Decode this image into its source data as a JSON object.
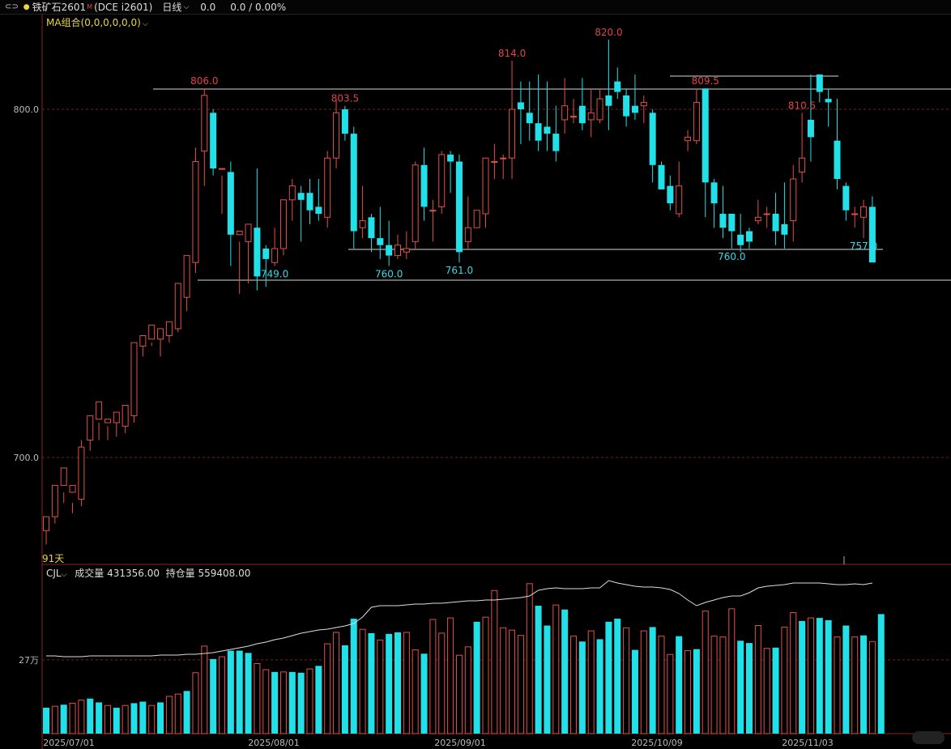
{
  "header": {
    "symbol": "铁矿石2601",
    "badge": "M",
    "exchange_code": "(DCE i2601)",
    "period": "日线",
    "last": "0.0",
    "change": "0.0 / 0.00%"
  },
  "indicators": {
    "ma_label": "MA组合(0,0,0,0,0,0)",
    "days_label": "91天",
    "volume_panel": "CJL",
    "volume_text": "成交量 431356.00",
    "oi_text": "持仓量 559408.00"
  },
  "colors": {
    "up": "#e0504a",
    "down": "#22e0e8",
    "grid": "#7a1f1f",
    "line": "#dddddd"
  },
  "chart_data": {
    "type": "candlestick",
    "price_axis_ticks": [
      800.0,
      700.0
    ],
    "volume_axis_tick": "27万",
    "date_labels": [
      "2025/07/01",
      "2025/08/01",
      "2025/09/01",
      "2025/10/09",
      "2025/11/03"
    ],
    "ylim": [
      671,
      832
    ],
    "candles": [
      [
        679,
        683,
        675,
        683
      ],
      [
        683,
        692,
        681,
        691
      ],
      [
        692,
        697,
        687,
        690
      ],
      [
        690,
        692,
        684,
        687
      ],
      [
        688,
        703,
        686,
        705
      ],
      [
        705,
        712,
        702,
        711
      ],
      [
        711,
        716,
        705,
        710
      ],
      [
        710,
        711,
        705,
        709
      ],
      [
        710,
        713,
        706,
        710
      ],
      [
        709,
        715,
        707,
        712
      ],
      [
        712,
        733,
        710,
        732
      ],
      [
        732,
        735,
        729,
        734
      ],
      [
        734,
        738,
        732,
        733
      ],
      [
        734,
        737,
        729,
        735
      ],
      [
        735,
        739,
        733,
        737
      ],
      [
        737,
        750,
        736,
        746
      ],
      [
        746,
        758,
        742,
        758
      ],
      [
        756,
        785,
        753,
        789
      ],
      [
        788,
        804,
        778,
        806
      ],
      [
        799,
        783,
        781,
        800
      ],
      [
        783,
        783,
        770,
        781
      ],
      [
        782,
        764,
        755,
        785
      ],
      [
        764,
        765,
        747,
        762
      ],
      [
        762,
        767,
        750,
        766
      ],
      [
        766,
        752,
        748,
        783
      ],
      [
        760,
        757,
        749,
        761
      ],
      [
        756,
        760,
        755,
        766
      ],
      [
        760,
        774,
        758,
        774
      ],
      [
        774,
        778,
        768,
        780
      ],
      [
        776,
        774,
        762,
        778
      ],
      [
        776,
        771,
        767,
        780
      ],
      [
        772,
        770,
        768,
        780
      ],
      [
        769,
        786,
        766,
        788
      ],
      [
        786,
        799,
        783,
        803
      ],
      [
        800,
        793,
        791,
        801
      ],
      [
        793,
        765,
        760,
        795
      ],
      [
        766,
        768,
        763,
        778
      ],
      [
        769,
        763,
        759,
        770
      ],
      [
        763,
        761,
        757,
        772
      ],
      [
        761,
        758,
        755,
        768
      ],
      [
        758,
        761,
        757,
        764
      ],
      [
        759,
        760,
        757,
        765
      ],
      [
        762,
        784,
        760,
        785
      ],
      [
        784,
        772,
        768,
        789
      ],
      [
        771,
        771,
        762,
        774
      ],
      [
        772,
        787,
        770,
        788
      ],
      [
        787,
        785,
        776,
        788
      ],
      [
        785,
        759,
        756,
        787
      ],
      [
        762,
        766,
        760,
        775
      ],
      [
        766,
        771,
        766,
        771
      ],
      [
        770,
        786,
        766,
        786
      ],
      [
        785,
        785,
        780,
        790
      ],
      [
        786,
        786,
        780,
        787
      ],
      [
        786,
        800,
        780,
        814
      ],
      [
        802,
        800,
        790,
        808
      ],
      [
        799,
        796,
        791,
        808
      ],
      [
        796,
        791,
        788,
        810
      ],
      [
        795,
        793,
        788,
        808
      ],
      [
        793,
        788,
        785,
        801
      ],
      [
        797,
        801,
        793,
        809
      ],
      [
        798,
        798,
        796,
        803
      ],
      [
        801,
        796,
        794,
        809
      ],
      [
        797,
        799,
        792,
        806
      ],
      [
        797,
        803,
        796,
        806
      ],
      [
        804,
        801,
        794,
        820
      ],
      [
        808,
        805,
        803,
        812
      ],
      [
        804,
        798,
        795,
        806
      ],
      [
        801,
        799,
        797,
        810
      ],
      [
        801,
        802,
        796,
        804
      ],
      [
        799,
        784,
        779,
        800
      ],
      [
        784,
        777,
        777,
        785
      ],
      [
        778,
        773,
        771,
        781
      ],
      [
        770,
        778,
        769,
        785
      ],
      [
        791,
        792,
        788,
        794
      ],
      [
        791,
        802,
        790,
        806
      ],
      [
        806,
        779,
        769,
        806
      ],
      [
        779,
        773,
        766,
        780
      ],
      [
        770,
        766,
        763,
        778
      ],
      [
        770,
        765,
        760,
        770
      ],
      [
        764,
        761,
        759,
        770
      ],
      [
        765,
        762,
        760,
        766
      ],
      [
        768,
        769,
        767,
        774
      ],
      [
        770,
        770,
        766,
        772
      ],
      [
        770,
        765,
        761,
        776
      ],
      [
        767,
        764,
        760,
        779
      ],
      [
        768,
        780,
        762,
        784
      ],
      [
        782,
        786,
        779,
        799
      ],
      [
        797,
        792,
        785,
        810
      ],
      [
        810,
        805,
        802,
        805
      ],
      [
        803,
        802,
        795,
        806
      ],
      [
        791,
        780,
        777,
        803
      ],
      [
        778,
        771,
        768,
        779
      ],
      [
        770,
        770,
        766,
        772
      ],
      [
        769,
        772,
        763,
        774
      ],
      [
        772,
        756,
        757,
        775
      ]
    ],
    "price_annotations": [
      {
        "label": "806.0",
        "kind": "high"
      },
      {
        "label": "803.5",
        "kind": "high"
      },
      {
        "label": "814.0",
        "kind": "high"
      },
      {
        "label": "820.0",
        "kind": "high"
      },
      {
        "label": "809.5",
        "kind": "high"
      },
      {
        "label": "810.5",
        "kind": "high"
      },
      {
        "label": "749.0",
        "kind": "low"
      },
      {
        "label": "760.0",
        "kind": "low"
      },
      {
        "label": "761.0",
        "kind": "low"
      },
      {
        "label": "760.0",
        "kind": "low"
      },
      {
        "label": "757.0",
        "kind": "low"
      }
    ],
    "volume": [
      [
        34,
        1
      ],
      [
        36,
        0
      ],
      [
        38,
        1
      ],
      [
        40,
        0
      ],
      [
        44,
        0
      ],
      [
        46,
        1
      ],
      [
        41,
        1
      ],
      [
        37,
        0
      ],
      [
        34,
        1
      ],
      [
        37,
        0
      ],
      [
        40,
        1
      ],
      [
        42,
        1
      ],
      [
        37,
        0
      ],
      [
        41,
        1
      ],
      [
        49,
        0
      ],
      [
        52,
        0
      ],
      [
        56,
        1
      ],
      [
        80,
        0
      ],
      [
        115,
        0
      ],
      [
        98,
        1
      ],
      [
        101,
        0
      ],
      [
        109,
        1
      ],
      [
        109,
        1
      ],
      [
        106,
        1
      ],
      [
        92,
        0
      ],
      [
        84,
        0
      ],
      [
        81,
        1
      ],
      [
        81,
        0
      ],
      [
        81,
        1
      ],
      [
        80,
        1
      ],
      [
        85,
        0
      ],
      [
        89,
        1
      ],
      [
        118,
        0
      ],
      [
        133,
        0
      ],
      [
        116,
        1
      ],
      [
        151,
        1
      ],
      [
        137,
        0
      ],
      [
        132,
        1
      ],
      [
        123,
        0
      ],
      [
        131,
        1
      ],
      [
        133,
        1
      ],
      [
        133,
        0
      ],
      [
        110,
        0
      ],
      [
        105,
        1
      ],
      [
        150,
        0
      ],
      [
        132,
        0
      ],
      [
        152,
        0
      ],
      [
        103,
        0
      ],
      [
        114,
        0
      ],
      [
        147,
        1
      ],
      [
        153,
        0
      ],
      [
        188,
        0
      ],
      [
        139,
        0
      ],
      [
        136,
        0
      ],
      [
        129,
        0
      ],
      [
        197,
        0
      ],
      [
        168,
        1
      ],
      [
        142,
        1
      ],
      [
        169,
        0
      ],
      [
        163,
        1
      ],
      [
        128,
        0
      ],
      [
        121,
        1
      ],
      [
        135,
        0
      ],
      [
        124,
        1
      ],
      [
        147,
        1
      ],
      [
        151,
        1
      ],
      [
        139,
        0
      ],
      [
        110,
        1
      ],
      [
        135,
        0
      ],
      [
        140,
        1
      ],
      [
        128,
        0
      ],
      [
        104,
        0
      ],
      [
        128,
        1
      ],
      [
        109,
        0
      ],
      [
        111,
        1
      ],
      [
        161,
        0
      ],
      [
        128,
        0
      ],
      [
        127,
        0
      ],
      [
        164,
        0
      ],
      [
        122,
        1
      ],
      [
        119,
        1
      ],
      [
        142,
        0
      ],
      [
        112,
        0
      ],
      [
        113,
        1
      ],
      [
        140,
        0
      ],
      [
        159,
        0
      ],
      [
        148,
        1
      ],
      [
        152,
        0
      ],
      [
        152,
        1
      ],
      [
        149,
        1
      ],
      [
        127,
        0
      ],
      [
        142,
        1
      ],
      [
        127,
        0
      ],
      [
        129,
        1
      ],
      [
        121,
        0
      ],
      [
        157,
        1
      ]
    ]
  }
}
